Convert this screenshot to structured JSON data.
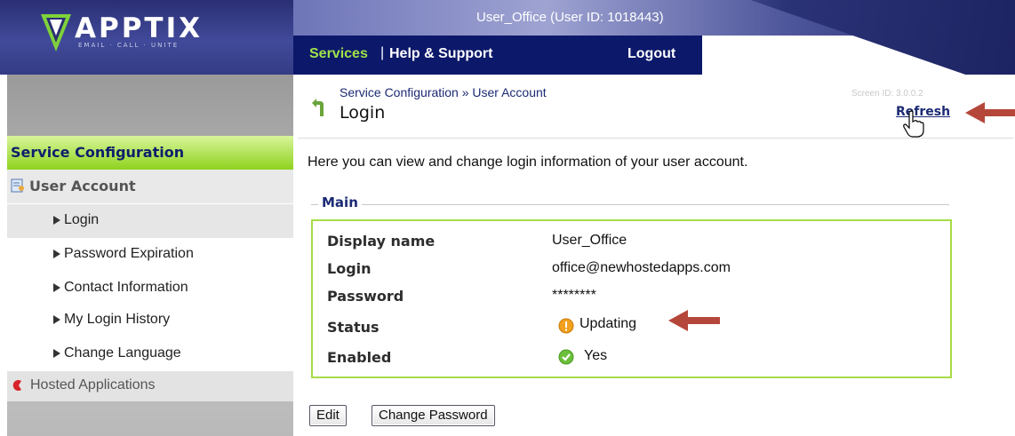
{
  "header": {
    "logo_text": "APPTIX",
    "logo_tagline": "EMAIL · CALL · UNITE",
    "user_label": "User_Office (User ID: 1018443)",
    "nav": {
      "services": "Services",
      "separator": "|",
      "help": "Help & Support",
      "logout": "Logout"
    }
  },
  "sidebar": {
    "title": "Service Configuration",
    "section": "User Account",
    "items": [
      {
        "label": "Login",
        "active": true
      },
      {
        "label": "Password Expiration",
        "active": false
      },
      {
        "label": "Contact Information",
        "active": false
      },
      {
        "label": "My Login History",
        "active": false
      },
      {
        "label": "Change Language",
        "active": false
      }
    ],
    "footer_item": "Hosted Applications"
  },
  "main": {
    "breadcrumb": "Service Configuration » User Account",
    "title": "Login",
    "screen_id": "Screen ID: 3.0.0.2",
    "refresh": "Refresh",
    "intro": "Here you can view and change login information of your user account.",
    "legend": "Main",
    "fields": {
      "display_name_label": "Display name",
      "display_name_value": "User_Office",
      "login_label": "Login",
      "login_value": "office@newhostedapps.com",
      "password_label": "Password",
      "password_value": "********",
      "status_label": "Status",
      "status_value": "Updating",
      "enabled_label": "Enabled",
      "enabled_value": "Yes"
    },
    "buttons": {
      "edit": "Edit",
      "change_password": "Change Password"
    }
  },
  "colors": {
    "nav_bg": "#0c186a",
    "nav_active": "#9fe34a",
    "sidebar_title": "#8fd21e",
    "box_border": "#a6dc47",
    "annotation_arrow": "#b5473a"
  },
  "icons": [
    "apptix-logo-icon",
    "user-account-icon",
    "back-arrow-icon",
    "hand-cursor-icon",
    "warning-icon",
    "check-icon",
    "hosted-apps-icon",
    "annotation-arrow-icon"
  ]
}
